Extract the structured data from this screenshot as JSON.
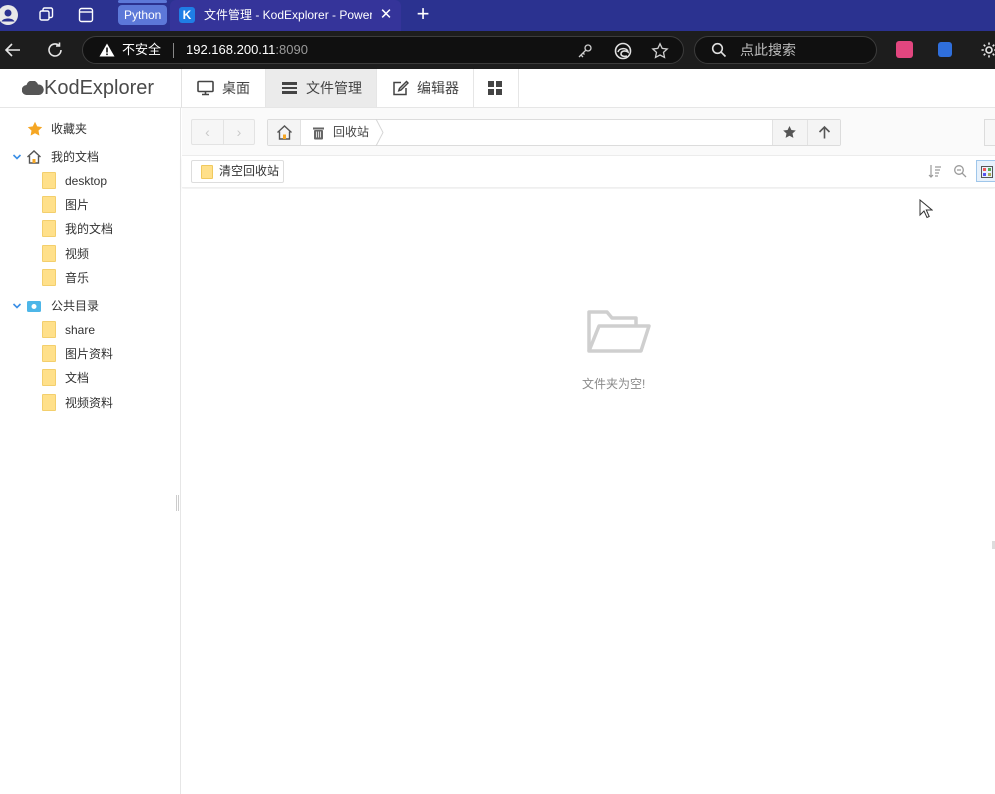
{
  "browser": {
    "tab_group_label": "Python",
    "active_tab": {
      "favicon_letter": "K",
      "title": "文件管理 - KodExplorer - Powered"
    },
    "address": {
      "security_label": "不安全",
      "host": "192.168.200.11",
      "port": ":8090"
    },
    "search_placeholder": "点此搜索"
  },
  "app": {
    "logo": "KodExplorer",
    "nav": [
      {
        "label": "桌面",
        "icon": "desktop-icon"
      },
      {
        "label": "文件管理",
        "icon": "file-manager-icon",
        "active": true
      },
      {
        "label": "编辑器",
        "icon": "editor-icon"
      },
      {
        "label": "",
        "icon": "apps-grid-icon"
      }
    ]
  },
  "sidebar": {
    "favorites": "收藏夹",
    "my_documents": {
      "label": "我的文档",
      "children": [
        "desktop",
        "图片",
        "我的文档",
        "视频",
        "音乐"
      ]
    },
    "public": {
      "label": "公共目录",
      "children": [
        "share",
        "图片资料",
        "文档",
        "视频资料"
      ]
    }
  },
  "path": {
    "current": "回收站"
  },
  "toolbar": {
    "empty_recycle_label": "清空回收站"
  },
  "main": {
    "empty_message": "文件夹为空!"
  },
  "colors": {
    "browser_titlebar": "#2b3290",
    "browser_toolbar": "#1d1d1d",
    "folder": "#ffe08a",
    "favorite_star": "#f5a623",
    "tree_caret": "#3a8ee6"
  }
}
